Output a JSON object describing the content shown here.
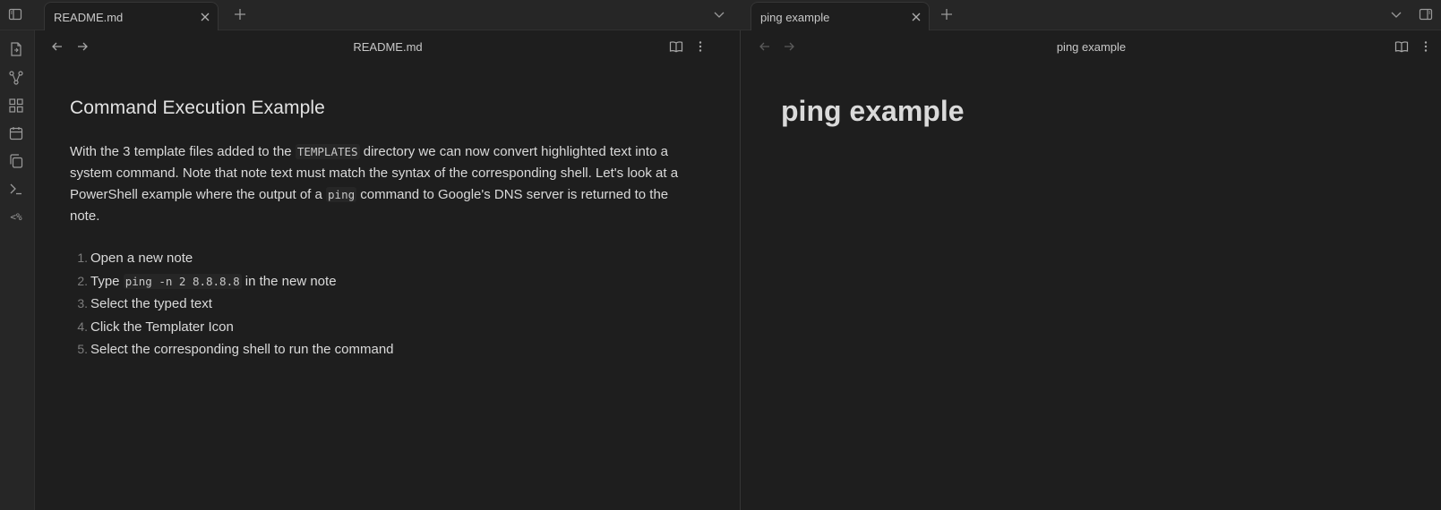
{
  "tabs": {
    "left": {
      "title": "README.md"
    },
    "right": {
      "title": "ping example"
    }
  },
  "ribbon": {
    "items": [
      "open-note-icon",
      "graph-icon",
      "plugins-icon",
      "calendar-icon",
      "copy-icon",
      "terminal-icon",
      "templater-icon"
    ],
    "templater_label": "<%"
  },
  "left_pane": {
    "header_title": "README.md",
    "heading": "Command Execution Example",
    "para_1": "With the 3 template files added to the ",
    "para_code_1": "TEMPLATES",
    "para_2": " directory we can now convert highlighted text into a system command. Note that note text must match the syntax of the corresponding shell. Let's look at a PowerShell example where the output of a ",
    "para_code_2": "ping",
    "para_3": " command to Google's DNS server is returned to the note.",
    "steps": [
      {
        "num": "1.",
        "text": "Open a new note"
      },
      {
        "num": "2.",
        "pre": "Type ",
        "code": "ping -n 2 8.8.8.8",
        "post": " in the new note"
      },
      {
        "num": "3.",
        "text": "Select the typed text"
      },
      {
        "num": "4.",
        "text": "Click the Templater Icon"
      },
      {
        "num": "5.",
        "text": "Select the corresponding shell to run the command"
      }
    ]
  },
  "right_pane": {
    "header_title": "ping example",
    "heading": "ping example"
  },
  "colors": {
    "background": "#1e1e1e",
    "chrome": "#262626",
    "text": "#dadada",
    "muted": "#7d7d7d"
  }
}
